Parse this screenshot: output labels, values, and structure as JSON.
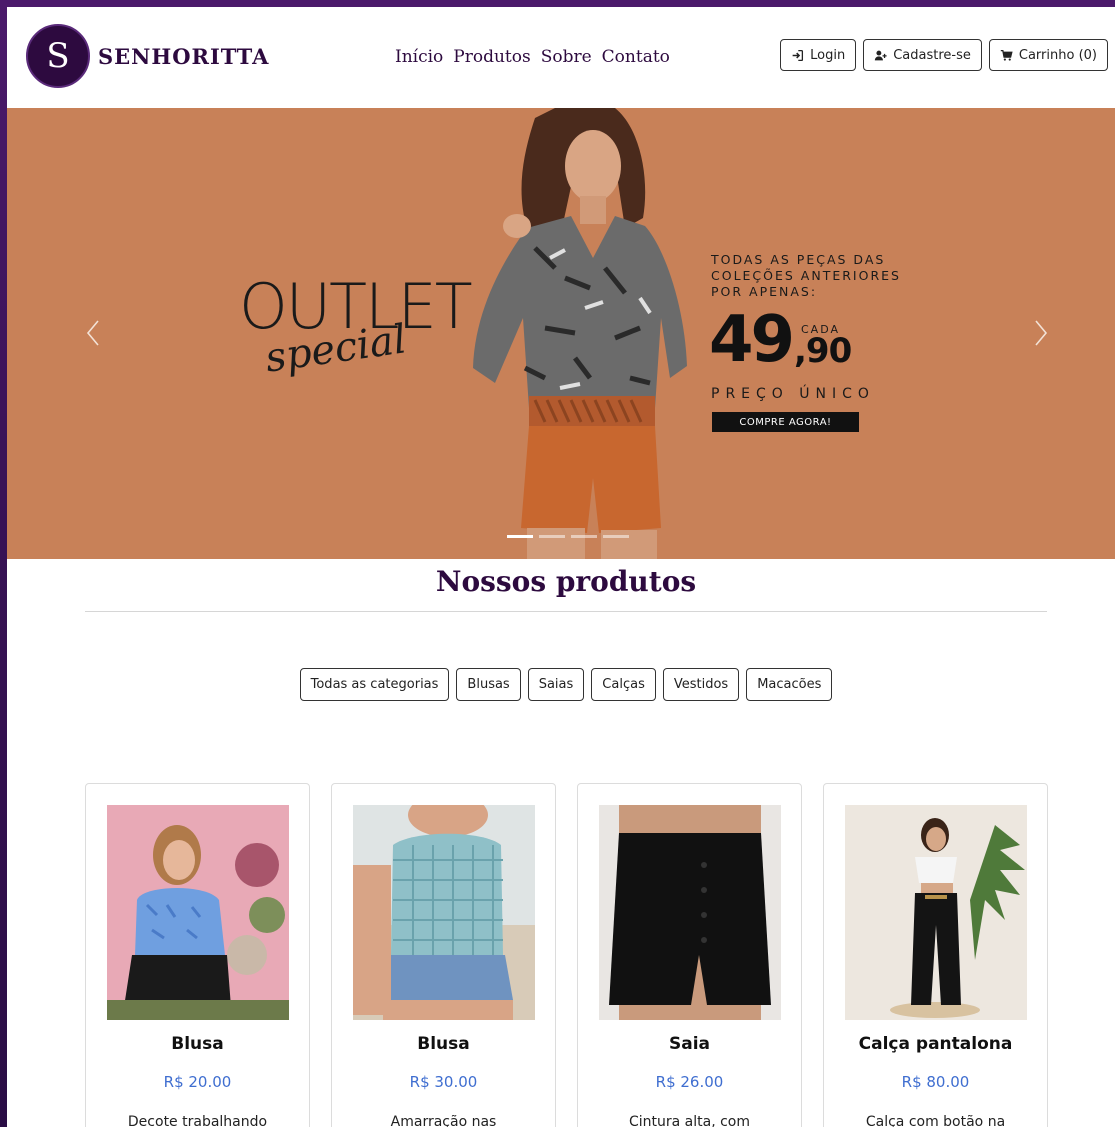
{
  "brand": {
    "letter": "S",
    "name": "SENHORITTA"
  },
  "nav": [
    {
      "label": "Início"
    },
    {
      "label": "Produtos"
    },
    {
      "label": "Sobre"
    },
    {
      "label": "Contato"
    }
  ],
  "header_buttons": {
    "login": "Login",
    "signup": "Cadastre-se",
    "cart": "Carrinho (0)"
  },
  "banner": {
    "outlet": "OUTLET",
    "special": "special",
    "promo_line1": "TODAS AS PEÇAS DAS",
    "promo_line2": "COLEÇÕES ANTERIORES",
    "promo_line3": "POR APENAS:",
    "price_main": "49",
    "price_cents": ",90",
    "cada": "CADA",
    "preco_unico": "PREÇO ÚNICO",
    "cta": "COMPRE AGORA!",
    "slide_count": 4,
    "active_slide": 1,
    "colors": {
      "background": "#c88158"
    }
  },
  "products_section": {
    "title": "Nossos produtos",
    "filters": [
      "Todas as categorias",
      "Blusas",
      "Saias",
      "Calças",
      "Vestidos",
      "Macacões"
    ]
  },
  "products": [
    {
      "name": "Blusa",
      "price": "R$ 20.00",
      "desc": "Decote trabalhando"
    },
    {
      "name": "Blusa",
      "price": "R$ 30.00",
      "desc": "Amarração nas"
    },
    {
      "name": "Saia",
      "price": "R$ 26.00",
      "desc": "Cintura alta, com"
    },
    {
      "name": "Calça pantalona",
      "price": "R$ 80.00",
      "desc": "Calça com botão na"
    }
  ],
  "colors": {
    "brand": "#2d0a3f",
    "price": "#3f6ed0",
    "page_background": "#3a1357"
  }
}
